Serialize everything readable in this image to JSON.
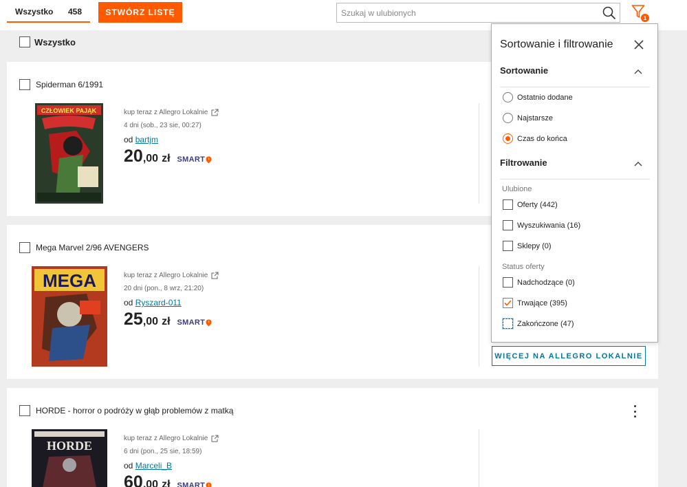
{
  "tabs": {
    "all_label": "Wszystko",
    "all_count": "458"
  },
  "toolbar": {
    "create_list_label": "STWÓRZ LISTĘ"
  },
  "search": {
    "placeholder": "Szukaj w ulubionych",
    "value": ""
  },
  "filter": {
    "badge_count": "1",
    "icon": "filter-icon"
  },
  "select_all": {
    "label": "Wszystko"
  },
  "items": [
    {
      "title": "Spiderman 6/1991",
      "source": "kup teraz z Allegro Lokalnie",
      "time": "4 dni (sob., 23 sie, 00:27)",
      "seller_prefix": "od",
      "seller": "bartjm",
      "price_main": "20",
      "price_cents": ",00",
      "currency": "zł",
      "badge": "SMART"
    },
    {
      "title": "Mega Marvel 2/96 AVENGERS",
      "source": "kup teraz z Allegro Lokalnie",
      "time": "20 dni (pon., 8 wrz, 21:20)",
      "seller_prefix": "od",
      "seller": "Ryszard-011",
      "price_main": "25",
      "price_cents": ",00",
      "currency": "zł",
      "badge": "SMART"
    },
    {
      "title": "HORDE - horror o podróży w głąb problemów z matką",
      "source": "kup teraz z Allegro Lokalnie",
      "time": "6 dni (pon., 25 sie, 18:59)",
      "seller_prefix": "od",
      "seller": "Marceli_B",
      "price_main": "60",
      "price_cents": ",00",
      "currency": "zł",
      "badge": "SMART"
    }
  ],
  "more_button": {
    "label": "WIĘCEJ NA ALLEGRO LOKALNIE"
  },
  "panel": {
    "title": "Sortowanie i filtrowanie",
    "sort_section": "Sortowanie",
    "sort_options": [
      {
        "label": "Ostatnio dodane",
        "selected": false
      },
      {
        "label": "Najstarsze",
        "selected": false
      },
      {
        "label": "Czas do końca",
        "selected": true
      }
    ],
    "filter_section": "Filtrowanie",
    "favorites_group": "Ulubione",
    "favorites_options": [
      {
        "label": "Oferty (442)",
        "checked": false
      },
      {
        "label": "Wyszukiwania (16)",
        "checked": false
      },
      {
        "label": "Sklepy (0)",
        "checked": false
      }
    ],
    "status_group": "Status oferty",
    "status_options": [
      {
        "label": "Nadchodzące (0)",
        "checked": false
      },
      {
        "label": "Trwające (395)",
        "checked": true
      },
      {
        "label": "Zakończone (47)",
        "checked": false
      }
    ]
  },
  "colors": {
    "accent": "#ff5a00",
    "link": "#00789e",
    "smart": "#3d3d7a"
  }
}
